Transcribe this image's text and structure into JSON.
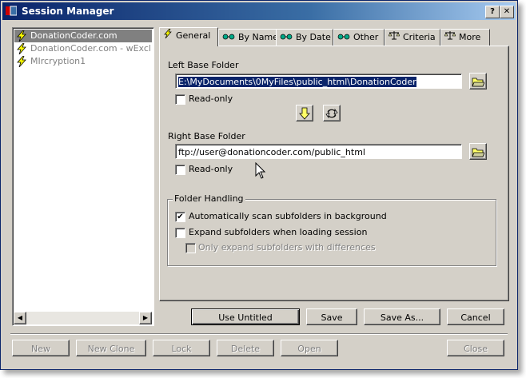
{
  "window": {
    "title": "Session Manager",
    "help_btn": "?",
    "close_btn": "✕"
  },
  "sessions": [
    {
      "label": "DonationCoder.com",
      "selected": true
    },
    {
      "label": "DonationCoder.com - wExclusion",
      "selected": false
    },
    {
      "label": "MIrcryption1",
      "selected": false
    }
  ],
  "tabs": [
    {
      "label": "General",
      "icon": "lightning-icon",
      "active": true
    },
    {
      "label": "By Name",
      "icon": "glasses-icon"
    },
    {
      "label": "By Date",
      "icon": "glasses-icon"
    },
    {
      "label": "Other",
      "icon": "glasses-icon"
    },
    {
      "label": "Criteria",
      "icon": "scales-icon"
    },
    {
      "label": "More",
      "icon": "scales-icon"
    }
  ],
  "general": {
    "left_label": "Left Base Folder",
    "left_value": "E:\\MyDocuments\\0MyFiles\\public_html\\DonationCoder",
    "left_readonly_label": "Read-only",
    "left_readonly_checked": false,
    "right_label": "Right Base Folder",
    "right_value": "ftp://user@donationcoder.com/public_html",
    "right_readonly_label": "Read-only",
    "right_readonly_checked": false,
    "folder_handling": {
      "title": "Folder Handling",
      "auto_scan_label": "Automatically scan subfolders in background",
      "auto_scan_checked": true,
      "expand_label": "Expand subfolders when loading session",
      "expand_checked": false,
      "only_diff_label": "Only expand subfolders with differences",
      "only_diff_checked": false
    }
  },
  "action_buttons": {
    "use_untitled": "Use Untitled",
    "save": "Save",
    "save_as": "Save As...",
    "cancel": "Cancel"
  },
  "bottom_buttons": {
    "new": "New",
    "new_clone": "New Clone",
    "lock": "Lock",
    "delete": "Delete",
    "open": "Open",
    "close": "Close"
  },
  "colors": {
    "title_start": "#0a246a",
    "title_end": "#a6caf0",
    "face": "#d4d0c8",
    "selection": "#0a246a"
  }
}
